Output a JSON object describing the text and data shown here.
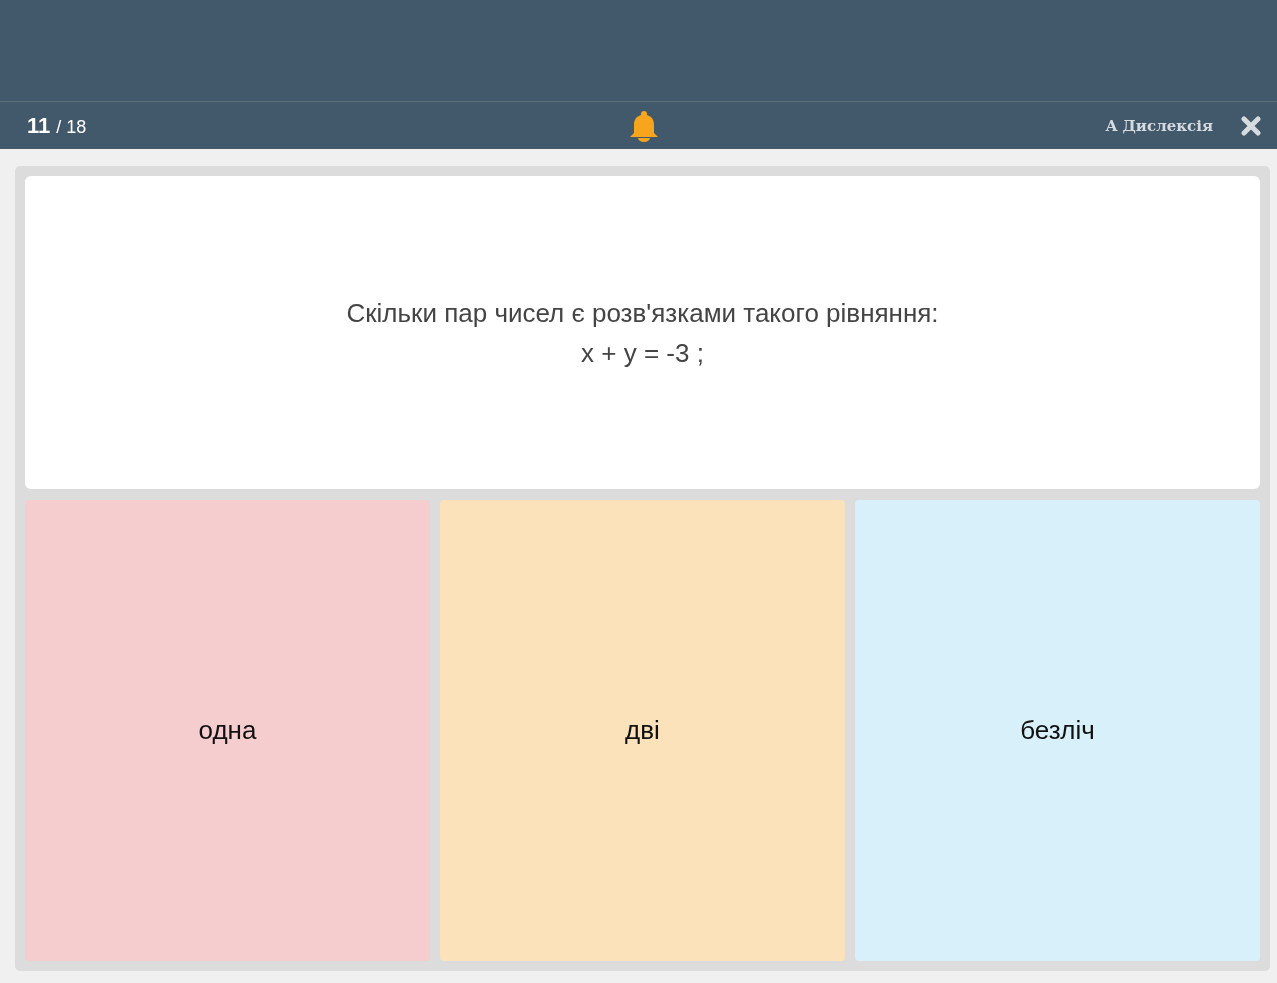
{
  "header": {
    "current": "11",
    "total": "/ 18",
    "dyslexia_label": "A Дислексія"
  },
  "question": {
    "lines": [
      "Скільки пар чисел є розв'язками такого рівняння:",
      "x + y = -3 ;"
    ]
  },
  "answers": [
    {
      "text": "одна",
      "color": "#f6cdcf"
    },
    {
      "text": "дві",
      "color": "#fbe2bb"
    },
    {
      "text": "безліч",
      "color": "#d8f0fa"
    }
  ]
}
